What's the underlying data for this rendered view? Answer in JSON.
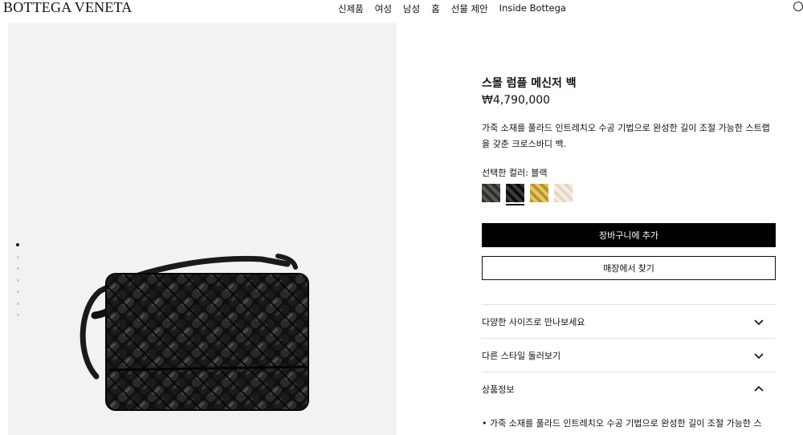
{
  "header": {
    "logo": "BOTTEGA VENETA",
    "nav": [
      {
        "label": "신제품"
      },
      {
        "label": "여성"
      },
      {
        "label": "남성"
      },
      {
        "label": "홈"
      },
      {
        "label": "선물 제안"
      },
      {
        "label": "Inside Bottega"
      }
    ]
  },
  "gallery": {
    "image_count": 7,
    "active_image": 1
  },
  "product": {
    "title": "스몰 럼플 메신저 백",
    "price": "₩4,790,000",
    "description": "가죽 소재를 풀라드 인트레치오 수공 기법으로 완성한 길이 조절 가능한 스트랩을 갖춘 크로스바디 백.",
    "selected_color_label": "선택한 컬러: 블랙",
    "swatches": [
      {
        "name": "dark-olive",
        "color": "#3a3b36",
        "selected": false
      },
      {
        "name": "black",
        "color": "#161616",
        "selected": true
      },
      {
        "name": "gold",
        "color": "#c9a73a",
        "selected": false
      },
      {
        "name": "cream",
        "color": "#ece2d2",
        "selected": false
      }
    ]
  },
  "actions": {
    "add_to_cart": "장바구니에 추가",
    "find_in_store": "매장에서 찾기"
  },
  "accordion": [
    {
      "label": "다양한 사이즈로 만나보세요",
      "expanded": false
    },
    {
      "label": "다른 스타일 둘러보기",
      "expanded": false
    },
    {
      "label": "상품정보",
      "expanded": true
    }
  ],
  "product_info": {
    "first_bullet": "• 가죽 소재를 풀라드 인트레치오 수공 기법으로 완성한 길이 조절 가능한 스"
  }
}
